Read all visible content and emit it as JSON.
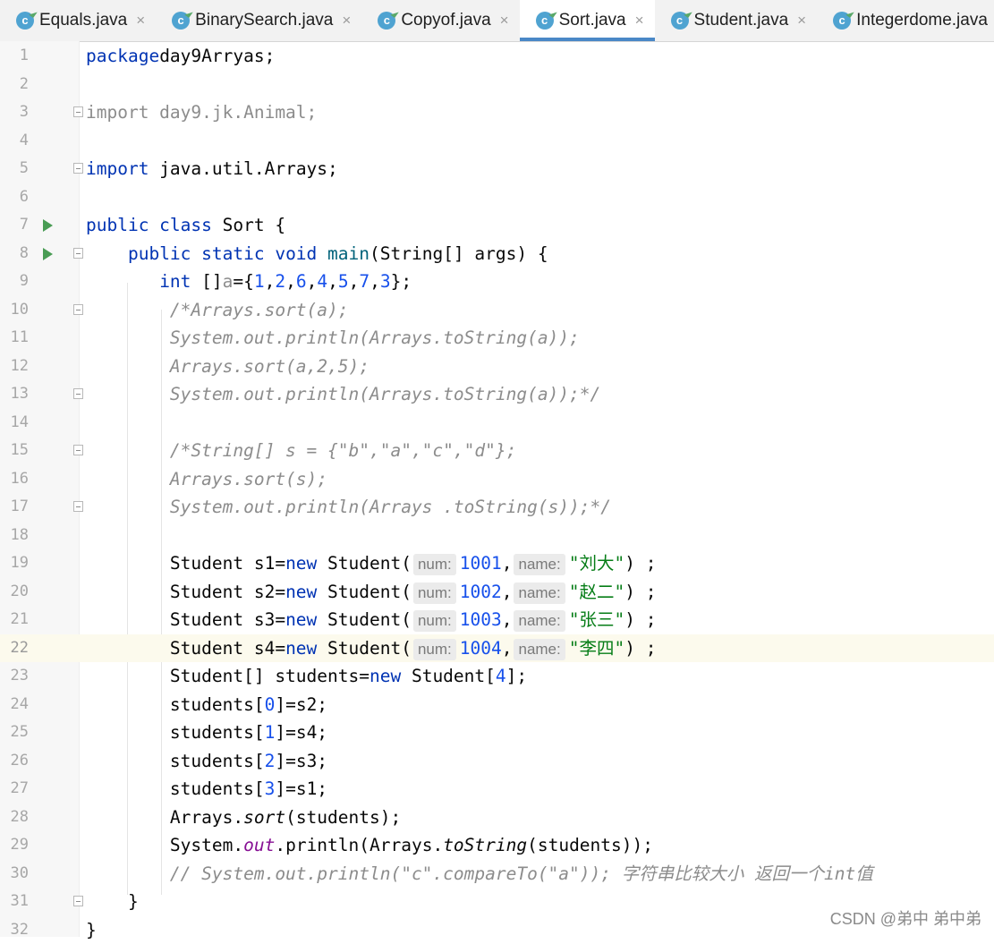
{
  "tabs": [
    {
      "label": "Equals.java",
      "active": false
    },
    {
      "label": "BinarySearch.java",
      "active": false
    },
    {
      "label": "Copyof.java",
      "active": false
    },
    {
      "label": "Sort.java",
      "active": true
    },
    {
      "label": "Student.java",
      "active": false
    },
    {
      "label": "Integerdome.java",
      "active": false
    }
  ],
  "tab_icon_letter": "c",
  "tab_close_glyph": "×",
  "colors": {
    "keyword": "#0033b3",
    "number": "#1750eb",
    "string": "#067d17",
    "comment": "#8c8c8c",
    "field": "#871094",
    "active_tab_underline": "#4a88c7",
    "current_line": "#fcfaed",
    "run_icon": "#499c54"
  },
  "lines": [
    {
      "n": "1",
      "t": [
        [
          "kw",
          "package"
        ],
        [
          "",
          "day9Arryas;"
        ]
      ]
    },
    {
      "n": "2",
      "t": []
    },
    {
      "n": "3",
      "fold": true,
      "t": [
        [
          "gry",
          "import day9.jk.Animal;"
        ]
      ]
    },
    {
      "n": "4",
      "t": []
    },
    {
      "n": "5",
      "fold": true,
      "t": [
        [
          "kw",
          "import"
        ],
        [
          "",
          " java.util.Arrays;"
        ]
      ]
    },
    {
      "n": "6",
      "t": []
    },
    {
      "n": "7",
      "run": true,
      "t": [
        [
          "kw",
          "public class"
        ],
        [
          "",
          " Sort {"
        ]
      ]
    },
    {
      "n": "8",
      "run": true,
      "fold": true,
      "t": [
        [
          "",
          "    "
        ],
        [
          "kw",
          "public static void"
        ],
        [
          "",
          " "
        ],
        [
          "fn",
          "main"
        ],
        [
          "",
          "(String[] args) {"
        ]
      ]
    },
    {
      "n": "9",
      "t": [
        [
          "",
          "       "
        ],
        [
          "kw",
          "int"
        ],
        [
          "",
          " []"
        ],
        [
          "gry",
          "a"
        ],
        [
          "",
          "={"
        ],
        [
          "num",
          "1"
        ],
        [
          "",
          ","
        ],
        [
          "num",
          "2"
        ],
        [
          "",
          ","
        ],
        [
          "num",
          "6"
        ],
        [
          "",
          ","
        ],
        [
          "num",
          "4"
        ],
        [
          "",
          ","
        ],
        [
          "num",
          "5"
        ],
        [
          "",
          ","
        ],
        [
          "num",
          "7"
        ],
        [
          "",
          ","
        ],
        [
          "num",
          "3"
        ],
        [
          "",
          "};"
        ]
      ]
    },
    {
      "n": "10",
      "fold": true,
      "t": [
        [
          "",
          "        "
        ],
        [
          "cmt",
          "/*Arrays.sort(a);"
        ]
      ]
    },
    {
      "n": "11",
      "t": [
        [
          "",
          "        "
        ],
        [
          "cmt",
          "System.out.println(Arrays.toString(a));"
        ]
      ]
    },
    {
      "n": "12",
      "t": [
        [
          "",
          "        "
        ],
        [
          "cmt",
          "Arrays.sort(a,2,5);"
        ]
      ]
    },
    {
      "n": "13",
      "fold": true,
      "t": [
        [
          "",
          "        "
        ],
        [
          "cmt",
          "System.out.println(Arrays.toString(a));*/"
        ]
      ]
    },
    {
      "n": "14",
      "t": []
    },
    {
      "n": "15",
      "fold": true,
      "t": [
        [
          "",
          "        "
        ],
        [
          "cmt",
          "/*String[] s = {\"b\",\"a\",\"c\",\"d\"};"
        ]
      ]
    },
    {
      "n": "16",
      "t": [
        [
          "",
          "        "
        ],
        [
          "cmt",
          "Arrays.sort(s);"
        ]
      ]
    },
    {
      "n": "17",
      "fold": true,
      "t": [
        [
          "",
          "        "
        ],
        [
          "cmt",
          "System.out.println(Arrays .toString(s));*/"
        ]
      ]
    },
    {
      "n": "18",
      "t": []
    },
    {
      "n": "19",
      "t": [
        [
          "",
          "        Student s1="
        ],
        [
          "kw",
          "new"
        ],
        [
          "",
          " Student("
        ],
        [
          "hint",
          "num:"
        ],
        [
          "num",
          "1001"
        ],
        [
          "",
          ","
        ],
        [
          "hint",
          "name:"
        ],
        [
          "str",
          "\"刘大\""
        ],
        [
          "",
          ") ;"
        ]
      ]
    },
    {
      "n": "20",
      "t": [
        [
          "",
          "        Student s2="
        ],
        [
          "kw",
          "new"
        ],
        [
          "",
          " Student("
        ],
        [
          "hint",
          "num:"
        ],
        [
          "num",
          "1002"
        ],
        [
          "",
          ","
        ],
        [
          "hint",
          "name:"
        ],
        [
          "str",
          "\"赵二\""
        ],
        [
          "",
          ") ;"
        ]
      ]
    },
    {
      "n": "21",
      "t": [
        [
          "",
          "        Student s3="
        ],
        [
          "kw",
          "new"
        ],
        [
          "",
          " Student("
        ],
        [
          "hint",
          "num:"
        ],
        [
          "num",
          "1003"
        ],
        [
          "",
          ","
        ],
        [
          "hint",
          "name:"
        ],
        [
          "str",
          "\"张三\""
        ],
        [
          "",
          ") ;"
        ]
      ]
    },
    {
      "n": "22",
      "current": true,
      "t": [
        [
          "",
          "        Student s4="
        ],
        [
          "kw",
          "new"
        ],
        [
          "",
          " Student("
        ],
        [
          "hint",
          "num:"
        ],
        [
          "num",
          "1004"
        ],
        [
          "",
          ","
        ],
        [
          "hint",
          "name:"
        ],
        [
          "str",
          "\"李四\""
        ],
        [
          "",
          ") ;"
        ]
      ]
    },
    {
      "n": "23",
      "t": [
        [
          "",
          "        Student[] students="
        ],
        [
          "kw",
          "new"
        ],
        [
          "",
          " Student["
        ],
        [
          "num",
          "4"
        ],
        [
          "",
          "];"
        ]
      ]
    },
    {
      "n": "24",
      "t": [
        [
          "",
          "        students["
        ],
        [
          "num",
          "0"
        ],
        [
          "",
          "]=s2;"
        ]
      ]
    },
    {
      "n": "25",
      "t": [
        [
          "",
          "        students["
        ],
        [
          "num",
          "1"
        ],
        [
          "",
          "]=s4;"
        ]
      ]
    },
    {
      "n": "26",
      "t": [
        [
          "",
          "        students["
        ],
        [
          "num",
          "2"
        ],
        [
          "",
          "]=s3;"
        ]
      ]
    },
    {
      "n": "27",
      "t": [
        [
          "",
          "        students["
        ],
        [
          "num",
          "3"
        ],
        [
          "",
          "]=s1;"
        ]
      ]
    },
    {
      "n": "28",
      "t": [
        [
          "",
          "        Arrays."
        ],
        [
          "ita",
          "sort"
        ],
        [
          "",
          "(students);"
        ]
      ]
    },
    {
      "n": "29",
      "t": [
        [
          "",
          "        System."
        ],
        [
          "fld",
          "out"
        ],
        [
          "",
          ".println(Arrays."
        ],
        [
          "ita",
          "toString"
        ],
        [
          "",
          "(students));"
        ]
      ]
    },
    {
      "n": "30",
      "t": [
        [
          "",
          "        "
        ],
        [
          "cmt",
          "// System.out.println(\"c\".compareTo(\"a\")); 字符串比较大小 返回一个int值"
        ]
      ]
    },
    {
      "n": "31",
      "fold": true,
      "t": [
        [
          "",
          "    }"
        ]
      ]
    },
    {
      "n": "32",
      "t": [
        [
          "",
          "}"
        ]
      ]
    }
  ],
  "watermark": "CSDN @弟中 弟中弟"
}
